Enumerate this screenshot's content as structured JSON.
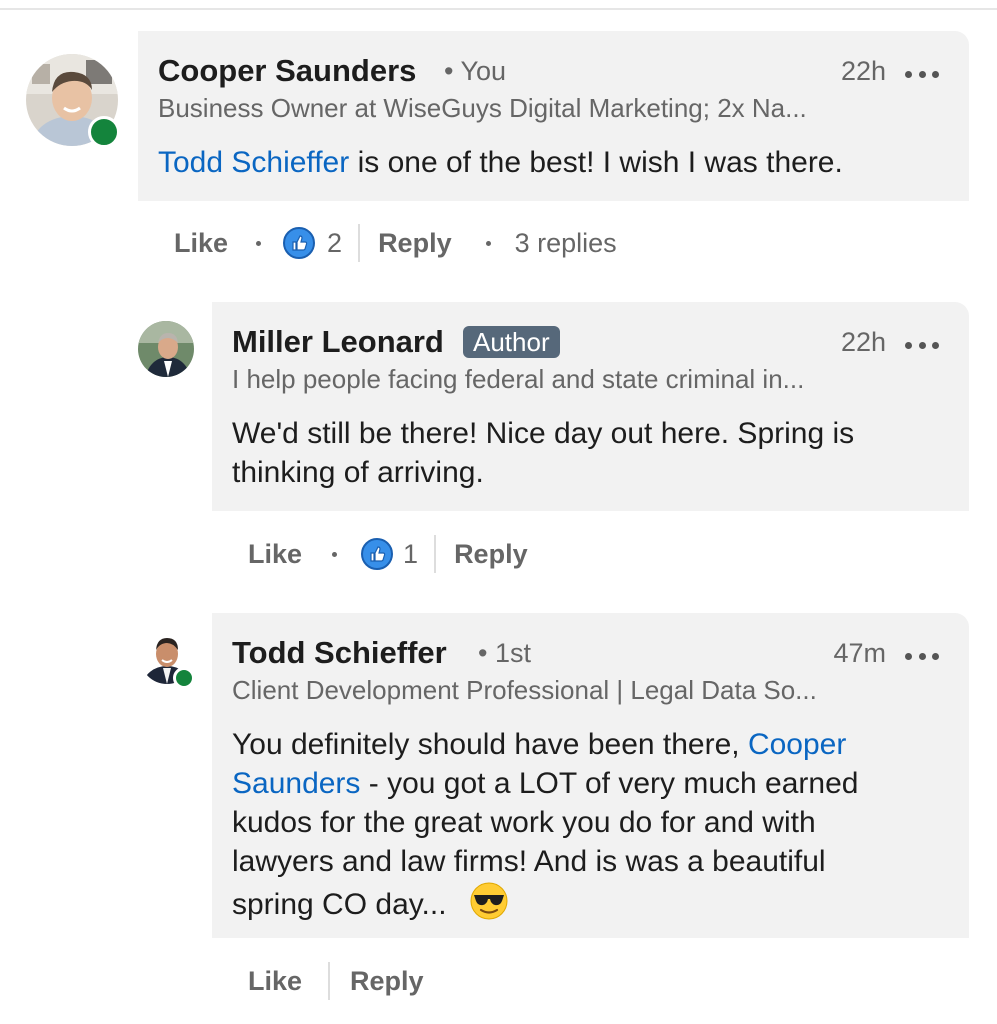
{
  "colors": {
    "bubble_bg": "#f2f2f2",
    "mention": "#0a66c2",
    "online": "#14843c",
    "author_badge": "#56687a",
    "reaction": "#378fe9"
  },
  "comments": [
    {
      "name": "Cooper Saunders",
      "degree": "• You",
      "time": "22h",
      "headline": "Business Owner at WiseGuys Digital Marketing; 2x Na...",
      "text_mention": "Todd Schieffer",
      "text_rest": " is one of the best! I wish I was there.",
      "actions": {
        "like": "Like",
        "reaction_count": "2",
        "reply": "Reply",
        "replies": "3 replies"
      },
      "avatar": "avatar-cooper",
      "online": true
    },
    {
      "name": "Miller Leonard",
      "badge": "Author",
      "time": "22h",
      "headline": "I help people facing federal and state criminal in...",
      "text_line1": "We'd still be there! Nice day out here. Spring is",
      "text_line2": "thinking of arriving.",
      "actions": {
        "like": "Like",
        "reaction_count": "1",
        "reply": "Reply"
      },
      "avatar": "avatar-miller",
      "online": false
    },
    {
      "name": "Todd Schieffer",
      "degree": "• 1st",
      "time": "47m",
      "headline": "Client Development Professional | Legal Data So...",
      "text_part1": "You definitely should have been there, ",
      "text_mention_1": "Cooper",
      "text_mention_2": "Saunders",
      "text_part2": " - you got a LOT of very much earned",
      "text_line3": "kudos for the great work you do for and with",
      "text_line4": "lawyers and law firms!  And is was a beautiful",
      "text_line5": "spring CO day...",
      "emoji": "smiling-face-with-sunglasses-icon",
      "actions": {
        "like": "Like",
        "reply": "Reply"
      },
      "avatar": "avatar-todd",
      "online": true
    }
  ]
}
